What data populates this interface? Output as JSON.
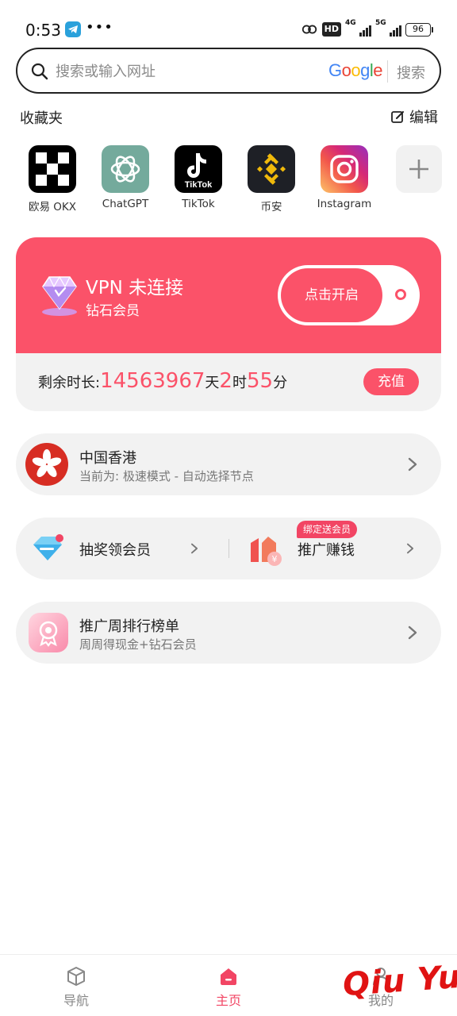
{
  "status_bar": {
    "time": "0:53",
    "dots": "•••",
    "hd_label": "HD",
    "net1": "4G",
    "net2": "5G",
    "battery": "96"
  },
  "search": {
    "placeholder": "搜索或输入网址",
    "engine": "Google",
    "button": "搜索"
  },
  "favorites": {
    "title": "收藏夹",
    "edit": "编辑",
    "items": [
      {
        "label": "欧易 OKX",
        "icon": "okx-icon"
      },
      {
        "label": "ChatGPT",
        "icon": "chatgpt-icon"
      },
      {
        "label": "TikTok",
        "icon": "tiktok-icon"
      },
      {
        "label": "币安",
        "icon": "binance-icon"
      },
      {
        "label": "Instagram",
        "icon": "instagram-icon"
      }
    ],
    "add_icon": "plus-icon"
  },
  "vpn": {
    "status": "VPN 未连接",
    "level": "钻石会员",
    "toggle_label": "点击开启",
    "remaining_prefix": "剩余时长:",
    "days": "14563967",
    "days_unit": "天",
    "hours": "2",
    "hours_unit": "时",
    "minutes": "55",
    "minutes_unit": "分",
    "recharge": "充值",
    "accent": "#fb5269"
  },
  "node": {
    "title": "中国香港",
    "subtitle": "当前为: 极速模式 - 自动选择节点"
  },
  "promo": {
    "lottery": "抽奖领会员",
    "earn": "推广赚钱",
    "badge": "绑定送会员"
  },
  "ranking": {
    "title": "推广周排行榜单",
    "subtitle": "周周得现金+钻石会员"
  },
  "bottom_nav": {
    "items": [
      {
        "label": "导航",
        "icon": "cube-icon"
      },
      {
        "label": "主页",
        "icon": "home-icon",
        "active": true
      },
      {
        "label": "我的",
        "icon": "user-icon"
      }
    ]
  },
  "watermark": "Qiu Yue"
}
